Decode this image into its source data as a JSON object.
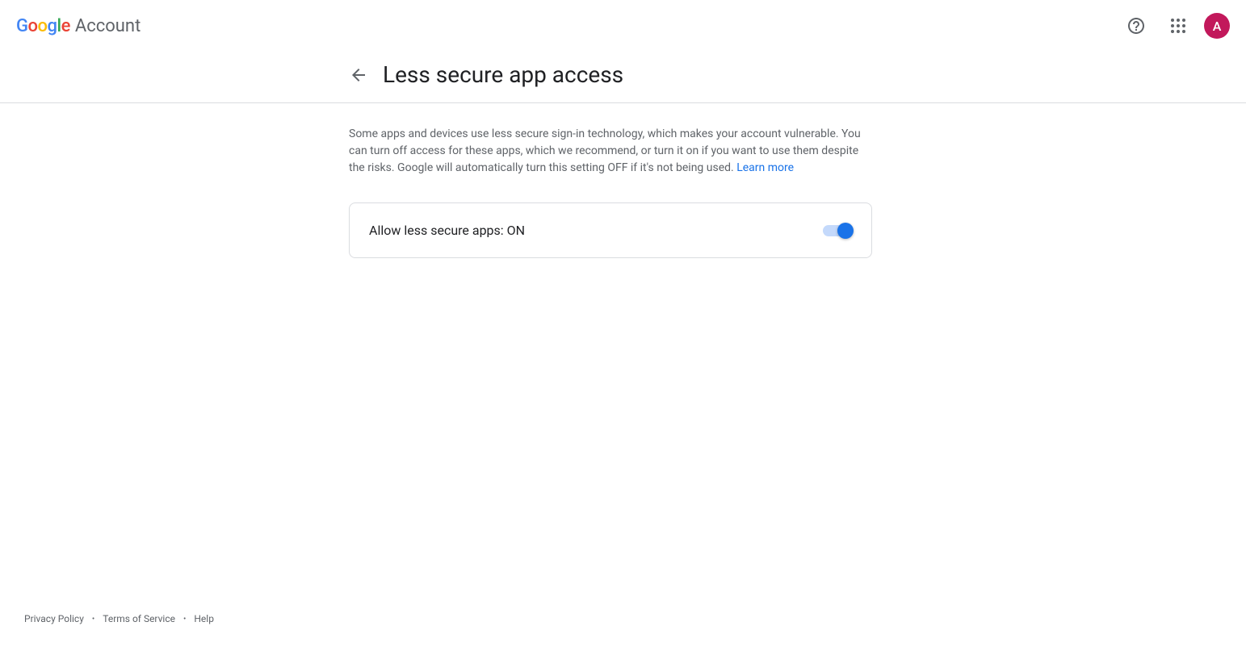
{
  "header": {
    "logo_account_text": "Account",
    "avatar_letter": "A"
  },
  "page": {
    "title": "Less secure app access",
    "description": "Some apps and devices use less secure sign-in technology, which makes your account vulnerable. You can turn off access for these apps, which we recommend, or turn it on if you want to use them despite the risks. Google will automatically turn this setting OFF if it's not being used. ",
    "learn_more_label": "Learn more"
  },
  "setting": {
    "label": "Allow less secure apps: ON"
  },
  "footer": {
    "privacy": "Privacy Policy",
    "terms": "Terms of Service",
    "help": "Help"
  }
}
